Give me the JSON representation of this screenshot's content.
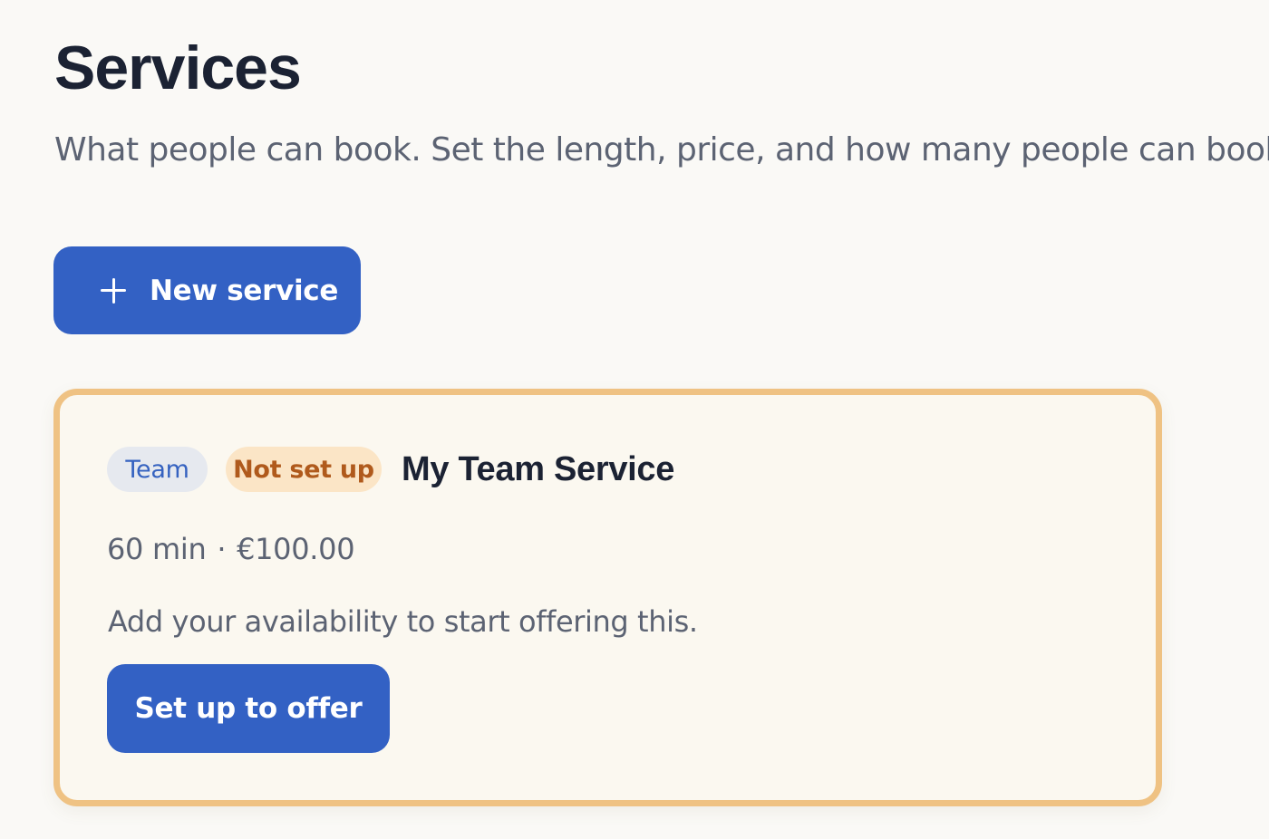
{
  "header": {
    "title": "Services",
    "subtitle": "What people can book. Set the length, price, and how many people can book at once."
  },
  "toolbar": {
    "new_service_label": "New service",
    "new_service_icon": "plus-icon"
  },
  "services": [
    {
      "badges": {
        "type": "Team",
        "status": "Not set up"
      },
      "name": "My Team Service",
      "duration": "60 min",
      "separator": "·",
      "price": "€100.00",
      "hint": "Add your availability to start offering this.",
      "action_label": "Set up to offer"
    }
  ],
  "colors": {
    "accent": "#3361c4",
    "warning_border": "#efc283",
    "warning_badge_bg": "#fbe5c6",
    "warning_badge_text": "#b05a1c",
    "team_badge_bg": "#e6e9ef",
    "team_badge_text": "#3562c0"
  }
}
